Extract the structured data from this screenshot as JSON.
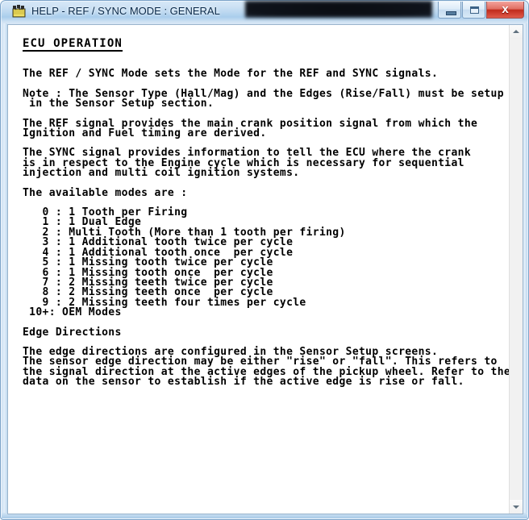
{
  "window": {
    "title": "HELP - REF / SYNC MODE : GENERAL",
    "icon": "help-book-icon",
    "redacted_caption": "",
    "controls": {
      "minimize": "minimize-button",
      "maximize": "maximize-button",
      "close_label": "x"
    },
    "colors": {
      "titlebar_glass": "#bcd8f0",
      "frame_border": "#7ba3c9",
      "close_button": "#c02b1c",
      "client_background": "#ffffff",
      "text": "#000000",
      "title_text": "#0b2a4a"
    }
  },
  "document": {
    "section_title": "ECU OPERATION",
    "paragraphs": {
      "p1": "The REF / SYNC Mode sets the Mode for the REF and SYNC signals.",
      "p2_line1": "Note : The Sensor Type (Hall/Mag) and the Edges (Rise/Fall) must be setup",
      "p2_line2": " in the Sensor Setup section.",
      "p3_line1": "The REF signal provides the main crank position signal from which the",
      "p3_line2": "Ignition and Fuel timing are derived.",
      "p4_line1": "The SYNC signal provides information to tell the ECU where the crank",
      "p4_line2": "is in respect to the Engine cycle which is necessary for sequential",
      "p4_line3": "injection and multi coil ignition systems.",
      "p5": "The available modes are :"
    },
    "modes": [
      "   0 : 1 Tooth per Firing",
      "   1 : 1 Dual Edge",
      "   2 : Multi Tooth (More than 1 tooth per firing)",
      "   3 : 1 Additional tooth twice per cycle",
      "   4 : 1 Additional tooth once  per cycle",
      "   5 : 1 Missing tooth twice per cycle",
      "   6 : 1 Missing tooth once  per cycle",
      "   7 : 2 Missing teeth twice per cycle",
      "   8 : 2 Missing teeth once  per cycle",
      "   9 : 2 Missing teeth four times per cycle",
      " 10+: OEM Modes"
    ],
    "edge_section_title": "Edge Directions",
    "edge_paragraph": {
      "line1": "The edge directions are configured in the Sensor Setup screens.",
      "line2": "The sensor edge direction may be either \"rise\" or \"fall\". This refers to",
      "line3": "the signal direction at the active edges of the pickup wheel. Refer to the",
      "line4": "data on the sensor to establish if the active edge is rise or fall."
    }
  },
  "scrollbar": {
    "up_arrow": "scroll-up-arrow",
    "down_arrow": "scroll-down-arrow",
    "thumb_visible": false
  }
}
